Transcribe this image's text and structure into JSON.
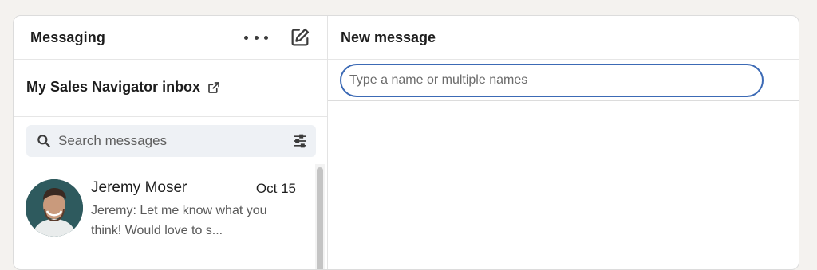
{
  "messaging": {
    "title": "Messaging",
    "inbox_label": "My Sales Navigator inbox",
    "search": {
      "placeholder": "Search messages",
      "value": ""
    },
    "conversations": [
      {
        "name": "Jeremy Moser",
        "date": "Oct 15",
        "preview": "Jeremy: Let me know what you think! Would love to s..."
      }
    ]
  },
  "compose": {
    "title": "New message",
    "recipient": {
      "placeholder": "Type a name or multiple names",
      "value": ""
    }
  },
  "icons": {
    "more": "more-horizontal-icon",
    "compose": "compose-icon",
    "external_link": "external-link-icon",
    "search": "search-icon",
    "filter": "filter-sliders-icon"
  },
  "colors": {
    "focus_ring": "#3c6ab5",
    "search_bg": "#eef1f5",
    "page_bg": "#f4f2ef"
  }
}
